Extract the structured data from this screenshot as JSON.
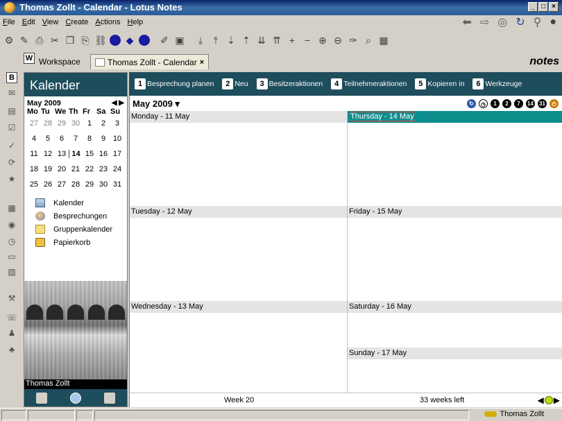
{
  "window": {
    "title": "Thomas Zollt - Calendar - Lotus Notes",
    "controls": [
      "_",
      "□",
      "×"
    ]
  },
  "menu": [
    "File",
    "Edit",
    "View",
    "Create",
    "Actions",
    "Help"
  ],
  "tabs": {
    "workspace_badge": "W",
    "workspace": "Workspace",
    "calendar": "Thomas Zollt - Calendar",
    "close": "×"
  },
  "brand": "notes",
  "bookmarks": {
    "badge": "B"
  },
  "navigator": {
    "title": "Kalender",
    "mini_calendar": {
      "month": "May 2009",
      "prev": "◀",
      "next": "▶",
      "weekdays": [
        "Mo",
        "Tu",
        "We",
        "Th",
        "Fr",
        "Sa",
        "Su"
      ],
      "weeks": [
        [
          "27",
          "28",
          "29",
          "30",
          "1",
          "2",
          "3"
        ],
        [
          "4",
          "5",
          "6",
          "7",
          "8",
          "9",
          "10"
        ],
        [
          "11",
          "12",
          "13",
          "14",
          "15",
          "16",
          "17"
        ],
        [
          "18",
          "19",
          "20",
          "21",
          "22",
          "23",
          "24"
        ],
        [
          "25",
          "26",
          "27",
          "28",
          "29",
          "30",
          "31"
        ]
      ]
    },
    "items": [
      "Kalender",
      "Besprechungen",
      "Gruppenkalender",
      "Papierkorb"
    ],
    "user": "Thomas Zollt"
  },
  "actions": [
    {
      "num": "1",
      "label": "Besprechung planen"
    },
    {
      "num": "2",
      "label": "Neu"
    },
    {
      "num": "3",
      "label": "Besitzeraktionen"
    },
    {
      "num": "4",
      "label": "Teilnehmeraktionen"
    },
    {
      "num": "5",
      "label": "Kopieren in"
    },
    {
      "num": "6",
      "label": "Werkzeuge"
    }
  ],
  "calendar": {
    "month_title": "May 2009 ▾",
    "view_buttons": [
      "1",
      "2",
      "7",
      "14",
      "31"
    ],
    "days": {
      "mon": "Monday - 11 May",
      "tue": "Tuesday - 12 May",
      "wed": "Wednesday - 13 May",
      "thu": "Thursday - 14 May",
      "fri": "Friday - 15 May",
      "sat": "Saturday - 16 May",
      "sun": "Sunday - 17 May"
    },
    "week_label": "Week 20",
    "weeks_left": "33 weeks left"
  },
  "status": {
    "user": "Thomas Zollt"
  }
}
